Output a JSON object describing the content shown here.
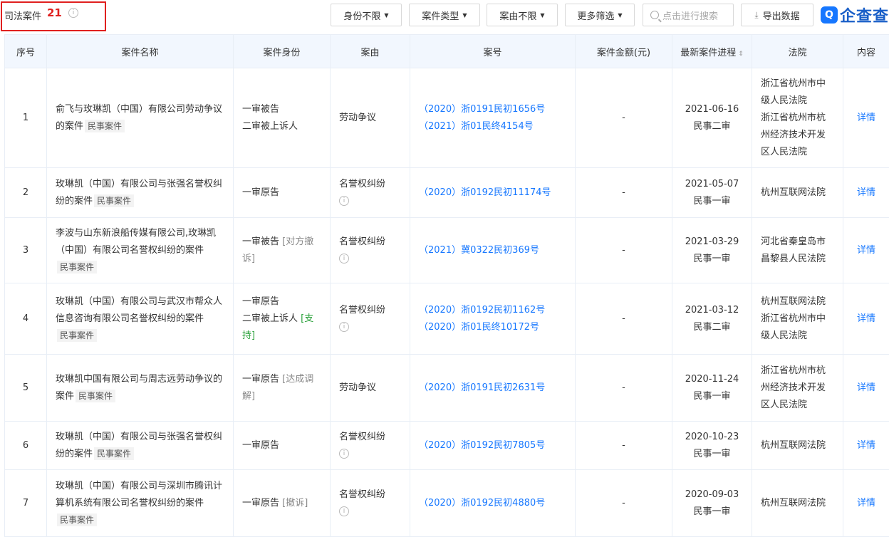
{
  "header": {
    "title": "司法案件",
    "count": "21",
    "filters": [
      "身份不限",
      "案件类型",
      "案由不限",
      "更多筛选"
    ],
    "search_placeholder": "点击进行搜索",
    "export_label": "导出数据",
    "brand_name": "企查查"
  },
  "columns": [
    "序号",
    "案件名称",
    "案件身份",
    "案由",
    "案号",
    "案件金额(元)",
    "最新案件进程",
    "法院",
    "内容"
  ],
  "rows": [
    {
      "index": "1",
      "name": "俞飞与玫琳凯（中国）有限公司劳动争议的案件",
      "tag": "民事案件",
      "roles": [
        {
          "text": "一审被告",
          "note": ""
        },
        {
          "text": "二审被上诉人",
          "note": ""
        }
      ],
      "cause": "劳动争议",
      "cause_info": false,
      "case_nos": [
        "（2020）浙0191民初1656号",
        "（2021）浙01民终4154号"
      ],
      "amount": "-",
      "date": "2021-06-16",
      "stage": "民事二审",
      "court": [
        "浙江省杭州市中级人民法院",
        "浙江省杭州市杭州经济技术开发区人民法院"
      ],
      "detail": "详情"
    },
    {
      "index": "2",
      "name": "玫琳凯（中国）有限公司与张强名誉权纠纷的案件",
      "tag": "民事案件",
      "roles": [
        {
          "text": "一审原告",
          "note": ""
        }
      ],
      "cause": "名誉权纠纷",
      "cause_info": true,
      "case_nos": [
        "（2020）浙0192民初11174号"
      ],
      "amount": "-",
      "date": "2021-05-07",
      "stage": "民事一审",
      "court": [
        "杭州互联网法院"
      ],
      "detail": "详情"
    },
    {
      "index": "3",
      "name": "李波与山东新浪船传媒有限公司,玫琳凯（中国）有限公司名誉权纠纷的案件",
      "tag": "民事案件",
      "roles": [
        {
          "text": "一审被告",
          "note": "[对方撤诉]"
        }
      ],
      "cause": "名誉权纠纷",
      "cause_info": true,
      "case_nos": [
        "（2021）冀0322民初369号"
      ],
      "amount": "-",
      "date": "2021-03-29",
      "stage": "民事一审",
      "court": [
        "河北省秦皇岛市昌黎县人民法院"
      ],
      "detail": "详情"
    },
    {
      "index": "4",
      "name": "玫琳凯（中国）有限公司与武汉市帮众人信息咨询有限公司名誉权纠纷的案件",
      "tag": "民事案件",
      "roles": [
        {
          "text": "一审原告",
          "note": ""
        },
        {
          "text": "二审被上诉人",
          "note": "[支持]"
        }
      ],
      "cause": "名誉权纠纷",
      "cause_info": true,
      "case_nos": [
        "（2020）浙0192民初1162号",
        "（2020）浙01民终10172号"
      ],
      "amount": "-",
      "date": "2021-03-12",
      "stage": "民事二审",
      "court": [
        "杭州互联网法院",
        "浙江省杭州市中级人民法院"
      ],
      "detail": "详情"
    },
    {
      "index": "5",
      "name": "玫琳凯中国有限公司与周志远劳动争议的案件",
      "tag": "民事案件",
      "roles": [
        {
          "text": "一审原告",
          "note": "[达成调解]"
        }
      ],
      "cause": "劳动争议",
      "cause_info": false,
      "case_nos": [
        "（2020）浙0191民初2631号"
      ],
      "amount": "-",
      "date": "2020-11-24",
      "stage": "民事一审",
      "court": [
        "浙江省杭州市杭州经济技术开发区人民法院"
      ],
      "detail": "详情"
    },
    {
      "index": "6",
      "name": "玫琳凯（中国）有限公司与张强名誉权纠纷的案件",
      "tag": "民事案件",
      "roles": [
        {
          "text": "一审原告",
          "note": ""
        }
      ],
      "cause": "名誉权纠纷",
      "cause_info": true,
      "case_nos": [
        "（2020）浙0192民初7805号"
      ],
      "amount": "-",
      "date": "2020-10-23",
      "stage": "民事一审",
      "court": [
        "杭州互联网法院"
      ],
      "detail": "详情"
    },
    {
      "index": "7",
      "name": "玫琳凯（中国）有限公司与深圳市腾讯计算机系统有限公司名誉权纠纷的案件",
      "tag": "民事案件",
      "roles": [
        {
          "text": "一审原告",
          "note": "[撤诉]"
        }
      ],
      "cause": "名誉权纠纷",
      "cause_info": true,
      "case_nos": [
        "（2020）浙0192民初4880号"
      ],
      "amount": "-",
      "date": "2020-09-03",
      "stage": "民事一审",
      "court": [
        "杭州互联网法院"
      ],
      "detail": "详情"
    }
  ],
  "colors": {
    "accent": "#1677ff",
    "highlight_border": "#e0201f",
    "header_bg": "#f2f7fe",
    "support_green": "#2aa13a"
  }
}
